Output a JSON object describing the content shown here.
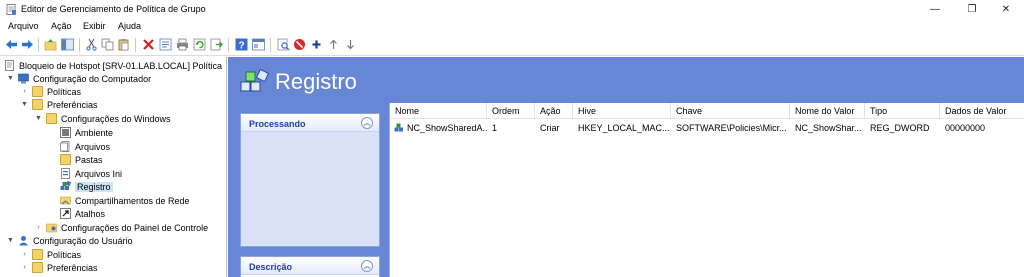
{
  "window": {
    "title": "Editor de Gerenciamento de Política de Grupo",
    "controls": {
      "minimize": "—",
      "restore": "❐",
      "close": "✕"
    }
  },
  "menu": {
    "items": [
      "Arquivo",
      "Ação",
      "Exibir",
      "Ajuda"
    ]
  },
  "toolbar": {
    "icons": [
      "back-icon",
      "forward-icon",
      "up-folder-icon",
      "show-tree-icon",
      "cut-icon",
      "copy-icon",
      "paste-icon",
      "delete-icon",
      "properties-icon",
      "print-icon",
      "refresh-icon",
      "export-icon",
      "help-icon",
      "view-icon",
      "filter-icon",
      "stop-icon",
      "add-icon",
      "move-up-icon",
      "move-down-icon"
    ]
  },
  "tree": {
    "root": "Bloqueio de Hotspot [SRV-01.LAB.LOCAL] Política",
    "computer_config": "Configuração do Computador",
    "policies": "Políticas",
    "preferences": "Preferências",
    "windows_settings": "Configurações do Windows",
    "environment": "Ambiente",
    "files": "Arquivos",
    "folders": "Pastas",
    "ini_files": "Arquivos Ini",
    "registry": "Registro",
    "network_shares": "Compartilhamentos de Rede",
    "shortcuts": "Atalhos",
    "control_panel": "Configurações do Painel de Controle",
    "user_config": "Configuração do Usuário",
    "user_policies": "Políticas",
    "user_preferences": "Preferências"
  },
  "main": {
    "title": "Registro",
    "panels": {
      "processing": "Processando",
      "description": "Descrição",
      "collapse_glyph": "︽"
    },
    "columns": [
      "Nome",
      "Ordem",
      "Ação",
      "Hive",
      "Chave",
      "Nome do Valor",
      "Tipo",
      "Dados de Valor"
    ],
    "rows": [
      {
        "name": "NC_ShowSharedA...",
        "order": "1",
        "action": "Criar",
        "hive": "HKEY_LOCAL_MAC...",
        "key": "SOFTWARE\\Policies\\Micr...",
        "value_name": "NC_ShowShar...",
        "type": "REG_DWORD",
        "value_data": "00000000"
      }
    ]
  },
  "colors": {
    "pane_blue": "#6787d6",
    "panel_title": "#1f3f9a",
    "selection": "#cce4f7"
  }
}
